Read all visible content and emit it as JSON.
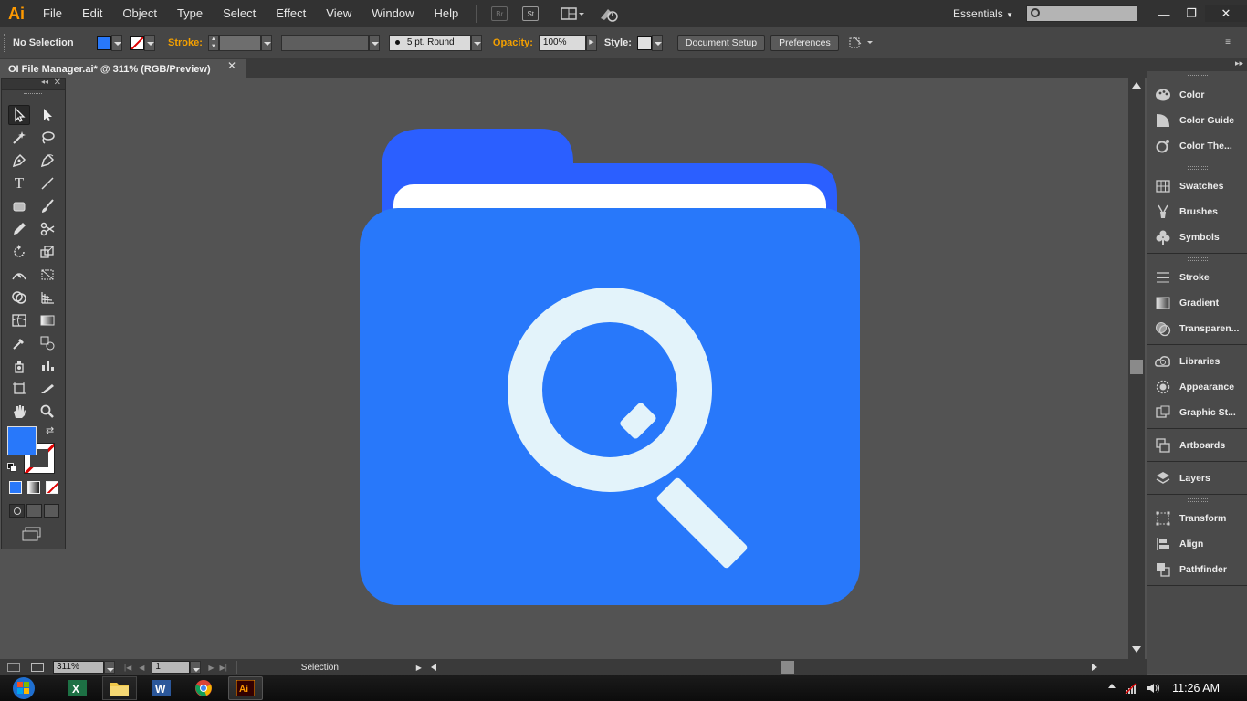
{
  "app": {
    "logo": "Ai",
    "menu": [
      "File",
      "Edit",
      "Object",
      "Type",
      "Select",
      "Effect",
      "View",
      "Window",
      "Help"
    ],
    "bridge_label": "Br",
    "stock_label": "St",
    "workspace": "Essentials",
    "window_controls": {
      "minimize": "—",
      "restore": "❐",
      "close": "✕"
    }
  },
  "control_bar": {
    "selection_label": "No Selection",
    "stroke_label": "Stroke:",
    "brush_value": "5 pt. Round",
    "opacity_label": "Opacity:",
    "opacity_value": "100%",
    "style_label": "Style:",
    "document_setup": "Document Setup",
    "preferences": "Preferences"
  },
  "document": {
    "tab_title": "OI File Manager.ai* @ 311% (RGB/Preview)",
    "close": "✕"
  },
  "artwork": {
    "folder_back_color": "#2b5fff",
    "folder_front_color": "#2878fa",
    "paper_color": "#ffffff",
    "magnifier_color": "#e3f3fa"
  },
  "colors": {
    "fill_swatch": "#2878fa",
    "accent": "#ff9a00"
  },
  "right_panel": {
    "groups": [
      [
        "Color",
        "Color Guide",
        "Color The..."
      ],
      [
        "Swatches",
        "Brushes",
        "Symbols"
      ],
      [
        "Stroke",
        "Gradient",
        "Transparen..."
      ],
      [
        "Libraries",
        "Appearance",
        "Graphic St..."
      ],
      [
        "Artboards"
      ],
      [
        "Layers"
      ],
      [
        "Transform",
        "Align",
        "Pathfinder"
      ]
    ]
  },
  "status_bar": {
    "zoom": "311%",
    "artboard": "1",
    "tool": "Selection"
  },
  "taskbar": {
    "time": "11:26 AM"
  }
}
